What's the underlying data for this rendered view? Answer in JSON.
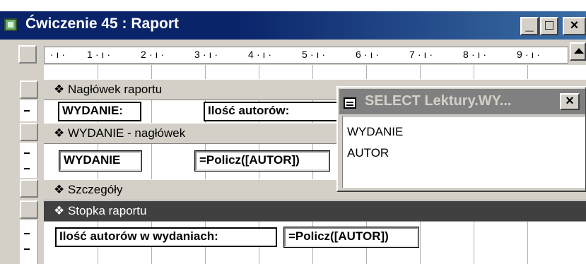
{
  "window": {
    "title": "Ćwiczenie 45 : Raport",
    "min_glyph": "_",
    "max_glyph": "□",
    "close_glyph": "×"
  },
  "ruler": {
    "marks": [
      "1",
      "2",
      "3",
      "4",
      "5",
      "6",
      "7",
      "8",
      "9"
    ]
  },
  "sections": {
    "report_header": "Nagłówek raportu",
    "group_header": "WYDANIE - nagłówek",
    "detail": "Szczegóły",
    "report_footer": "Stopka raportu"
  },
  "controls": {
    "header_label": "WYDANIE:",
    "header_count_label": "Ilość autorów:",
    "group_field": "WYDANIE",
    "group_count": "=Policz([AUTOR])",
    "footer_label": "Ilość autorów w wydaniach:",
    "footer_count": "=Policz([AUTOR])"
  },
  "field_list": {
    "title": "SELECT Lektury.WY...",
    "close_glyph": "×",
    "fields": [
      "WYDANIE",
      "AUTOR"
    ]
  }
}
